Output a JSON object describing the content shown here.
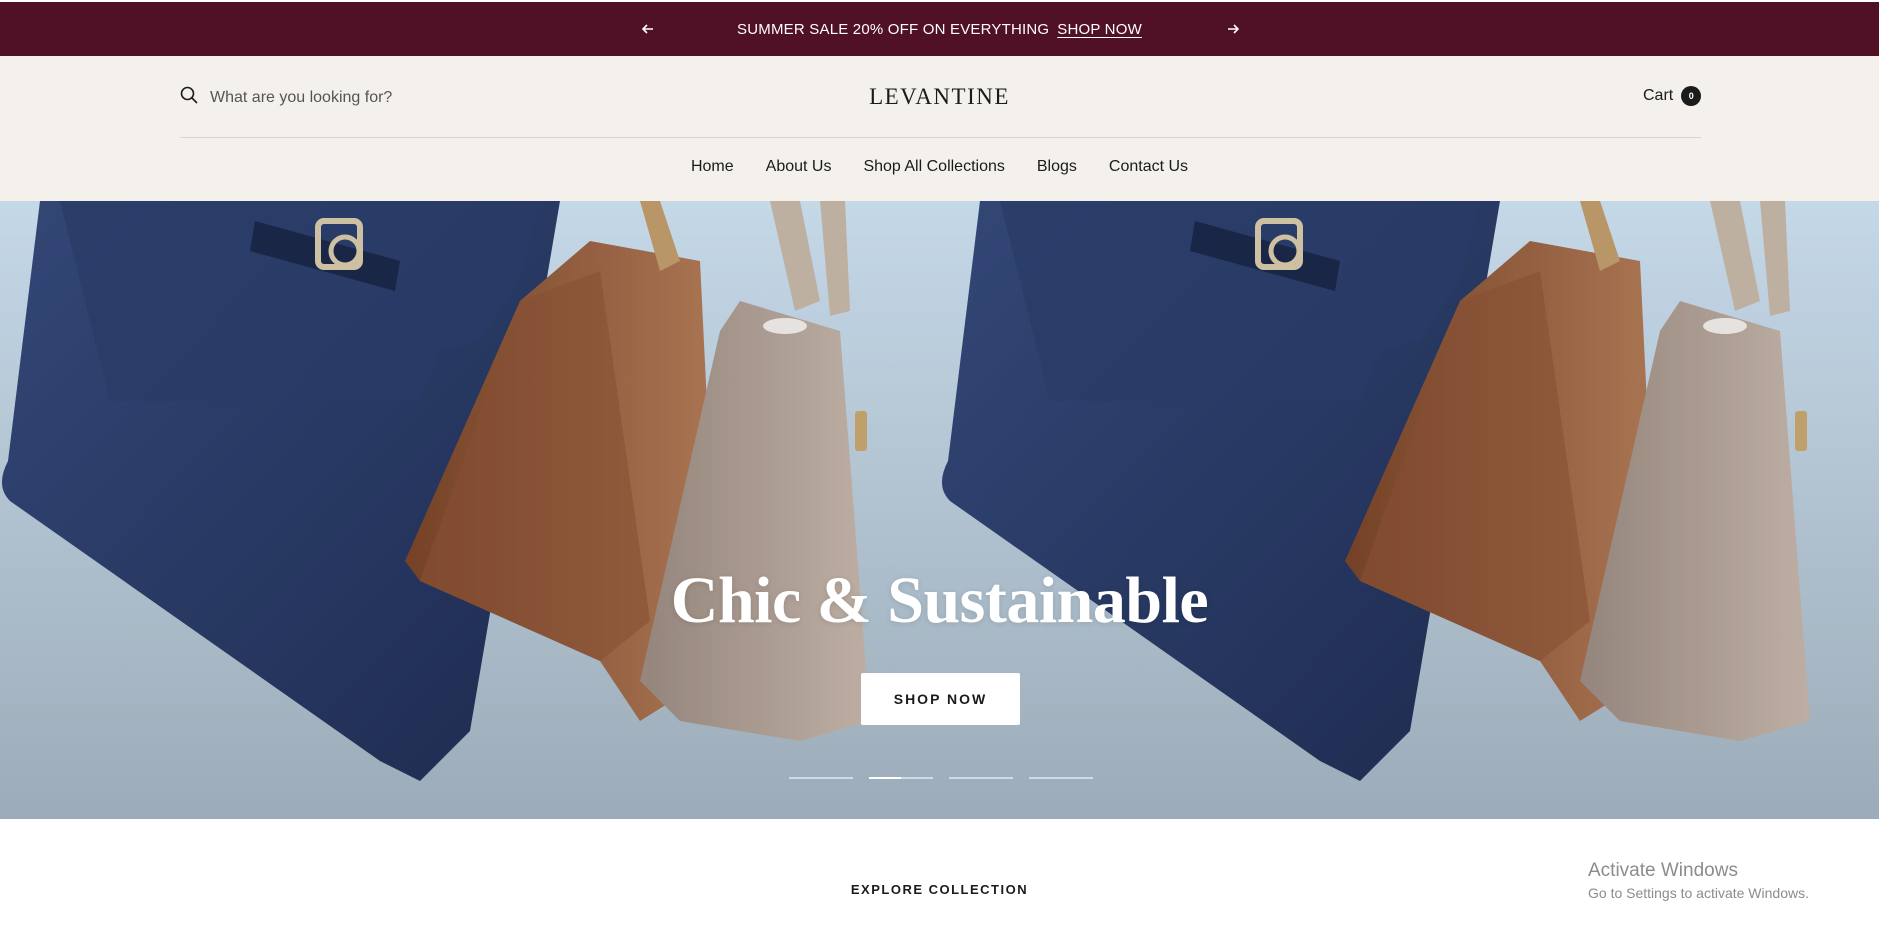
{
  "announcement": {
    "message": "SUMMER SALE 20% OFF ON EVERYTHING",
    "link": "SHOP NOW",
    "prev_icon": "arrow-left-icon",
    "next_icon": "arrow-right-icon",
    "background": "#501025"
  },
  "header": {
    "search_placeholder": "What are you looking for?",
    "search_icon": "search-icon",
    "logo": "LEVANTINE",
    "cart_label": "Cart",
    "cart_count": "0",
    "background": "#f4f1ec"
  },
  "nav": {
    "items": [
      {
        "label": "Home"
      },
      {
        "label": "About Us"
      },
      {
        "label": "Shop All Collections"
      },
      {
        "label": "Blogs"
      },
      {
        "label": "Contact Us"
      }
    ]
  },
  "hero": {
    "title": "Chic & Sustainable",
    "cta": "SHOP NOW",
    "slides": 4,
    "active_slide": 2
  },
  "explore": {
    "heading": "EXPLORE COLLECTION"
  },
  "watermark": {
    "line1": "Activate Windows",
    "line2": "Go to Settings to activate Windows."
  }
}
